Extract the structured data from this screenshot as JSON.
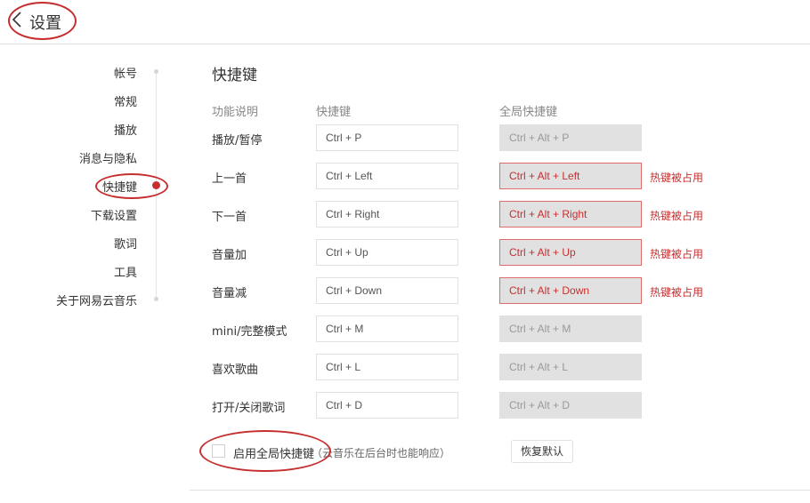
{
  "header": {
    "title": "设置",
    "back_icon": "chevron-left-icon"
  },
  "sidebar": {
    "items": [
      {
        "label": "帐号",
        "active": false
      },
      {
        "label": "常规",
        "active": false
      },
      {
        "label": "播放",
        "active": false
      },
      {
        "label": "消息与隐私",
        "active": false
      },
      {
        "label": "快捷键",
        "active": true
      },
      {
        "label": "下载设置",
        "active": false
      },
      {
        "label": "歌词",
        "active": false
      },
      {
        "label": "工具",
        "active": false
      },
      {
        "label": "关于网易云音乐",
        "active": false
      }
    ]
  },
  "main": {
    "title": "快捷键",
    "columns": {
      "function": "功能说明",
      "shortcut": "快捷键",
      "global": "全局快捷键"
    },
    "rows": [
      {
        "label": "播放/暂停",
        "key": "Ctrl + P",
        "global": "Ctrl + Alt + P",
        "conflict": ""
      },
      {
        "label": "上一首",
        "key": "Ctrl + Left",
        "global": "Ctrl + Alt + Left",
        "conflict": "热键被占用"
      },
      {
        "label": "下一首",
        "key": "Ctrl + Right",
        "global": "Ctrl + Alt + Right",
        "conflict": "热键被占用"
      },
      {
        "label": "音量加",
        "key": "Ctrl + Up",
        "global": "Ctrl + Alt + Up",
        "conflict": "热键被占用"
      },
      {
        "label": "音量减",
        "key": "Ctrl + Down",
        "global": "Ctrl + Alt + Down",
        "conflict": "热键被占用"
      },
      {
        "label": "mini/完整模式",
        "key": "Ctrl + M",
        "global": "Ctrl + Alt + M",
        "conflict": ""
      },
      {
        "label": "喜欢歌曲",
        "key": "Ctrl + L",
        "global": "Ctrl + Alt + L",
        "conflict": ""
      },
      {
        "label": "打开/关闭歌词",
        "key": "Ctrl + D",
        "global": "Ctrl + Alt + D",
        "conflict": ""
      }
    ],
    "enable_global": {
      "label": "启用全局快捷键",
      "hint": "（云音乐在后台时也能响应）",
      "checked": false
    },
    "restore_label": "恢复默认"
  },
  "colors": {
    "accent": "#c62f2f",
    "conflict_border": "#e06b6b",
    "disabled_bg": "#e1e1e2"
  }
}
